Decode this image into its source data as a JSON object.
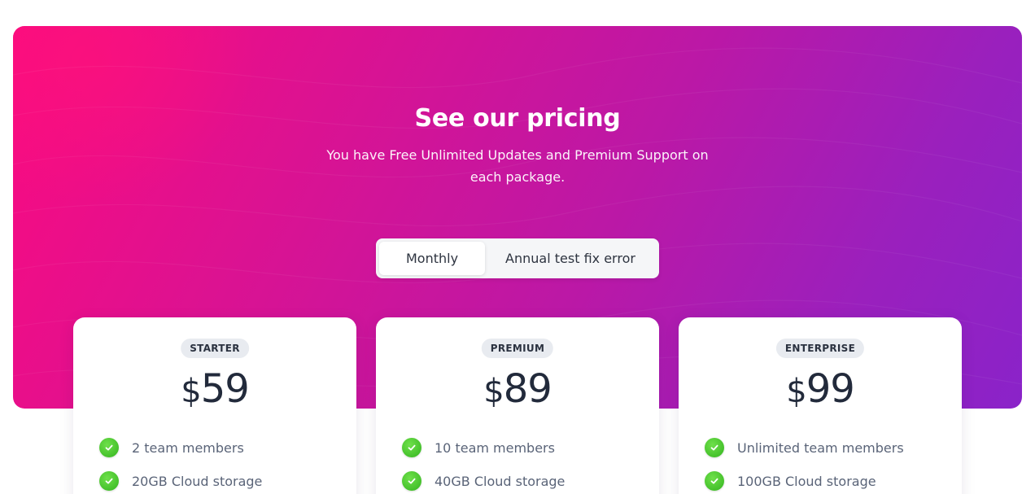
{
  "hero": {
    "title": "See our pricing",
    "subtitle": "You have Free Unlimited Updates and Premium Support on each package."
  },
  "billing_toggle": {
    "options": [
      "Monthly",
      "Annual test fix error"
    ],
    "selected": "Monthly"
  },
  "plans": [
    {
      "badge": "STARTER",
      "currency": "$",
      "price": "59",
      "features": [
        "2 team members",
        "20GB Cloud storage"
      ]
    },
    {
      "badge": "PREMIUM",
      "currency": "$",
      "price": "89",
      "features": [
        "10 team members",
        "40GB Cloud storage"
      ]
    },
    {
      "badge": "ENTERPRISE",
      "currency": "$",
      "price": "99",
      "features": [
        "Unlimited team members",
        "100GB Cloud storage"
      ]
    }
  ],
  "colors": {
    "gradient_start": "#fb0a80",
    "gradient_end": "#8a23c9",
    "check_green": "#3fbf2a",
    "price_text": "#222a3b",
    "badge_bg": "#e8ebf0"
  },
  "icons": {
    "feature_check": "check-circle-icon"
  }
}
